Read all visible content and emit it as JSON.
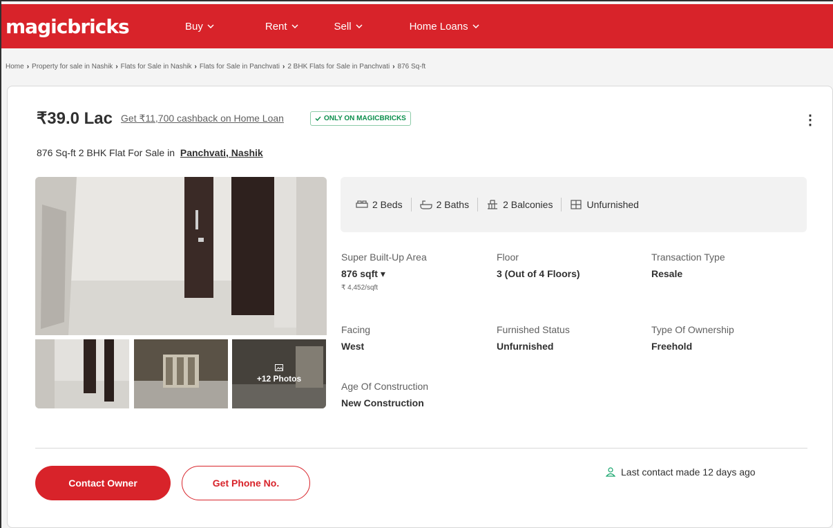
{
  "brand": {
    "logo_text": "magicbricks",
    "primary_color": "#d8232a"
  },
  "nav": {
    "items": [
      {
        "label": "Buy"
      },
      {
        "label": "Rent"
      },
      {
        "label": "Sell"
      },
      {
        "label": "Home Loans"
      }
    ]
  },
  "breadcrumb": [
    "Home",
    "Property for sale in Nashik",
    "Flats for Sale in Nashik",
    "Flats for Sale in Panchvati",
    "2 BHK Flats for Sale in Panchvati",
    "876 Sq-ft"
  ],
  "listing": {
    "price": "₹39.0 Lac",
    "cashback": "Get ₹11,700 cashback on Home Loan",
    "badge": "ONLY ON MAGICBRICKS",
    "title": "876 Sq-ft 2 BHK Flat For Sale in",
    "location": "Panchvati, Nashik",
    "photos_more": "+12 Photos",
    "amenities": {
      "beds": "2 Beds",
      "baths": "2 Baths",
      "balconies": "2 Balconies",
      "furnishing": "Unfurnished"
    },
    "specs": {
      "area_label": "Super Built-Up Area",
      "area_value": "876 sqft",
      "area_rate": "₹ 4,452/sqft",
      "floor_label": "Floor",
      "floor_value": "3 (Out of 4 Floors)",
      "transaction_label": "Transaction Type",
      "transaction_value": "Resale",
      "facing_label": "Facing",
      "facing_value": "West",
      "furnished_label": "Furnished Status",
      "furnished_value": "Unfurnished",
      "ownership_label": "Type Of Ownership",
      "ownership_value": "Freehold",
      "age_label": "Age Of Construction",
      "age_value": "New Construction"
    },
    "actions": {
      "contact_owner": "Contact Owner",
      "get_phone": "Get Phone No."
    },
    "last_contact": "Last contact made 12 days ago"
  }
}
